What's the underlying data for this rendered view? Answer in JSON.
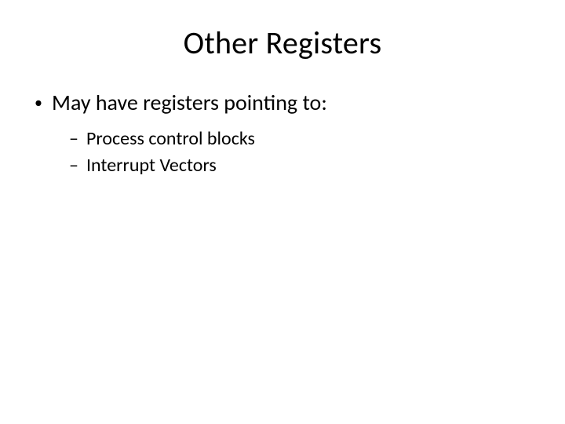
{
  "slide": {
    "title": "Other Registers",
    "bullets": [
      {
        "text": "May have registers pointing to:",
        "children": [
          {
            "text": "Process control blocks"
          },
          {
            "text": "Interrupt Vectors"
          }
        ]
      }
    ]
  }
}
